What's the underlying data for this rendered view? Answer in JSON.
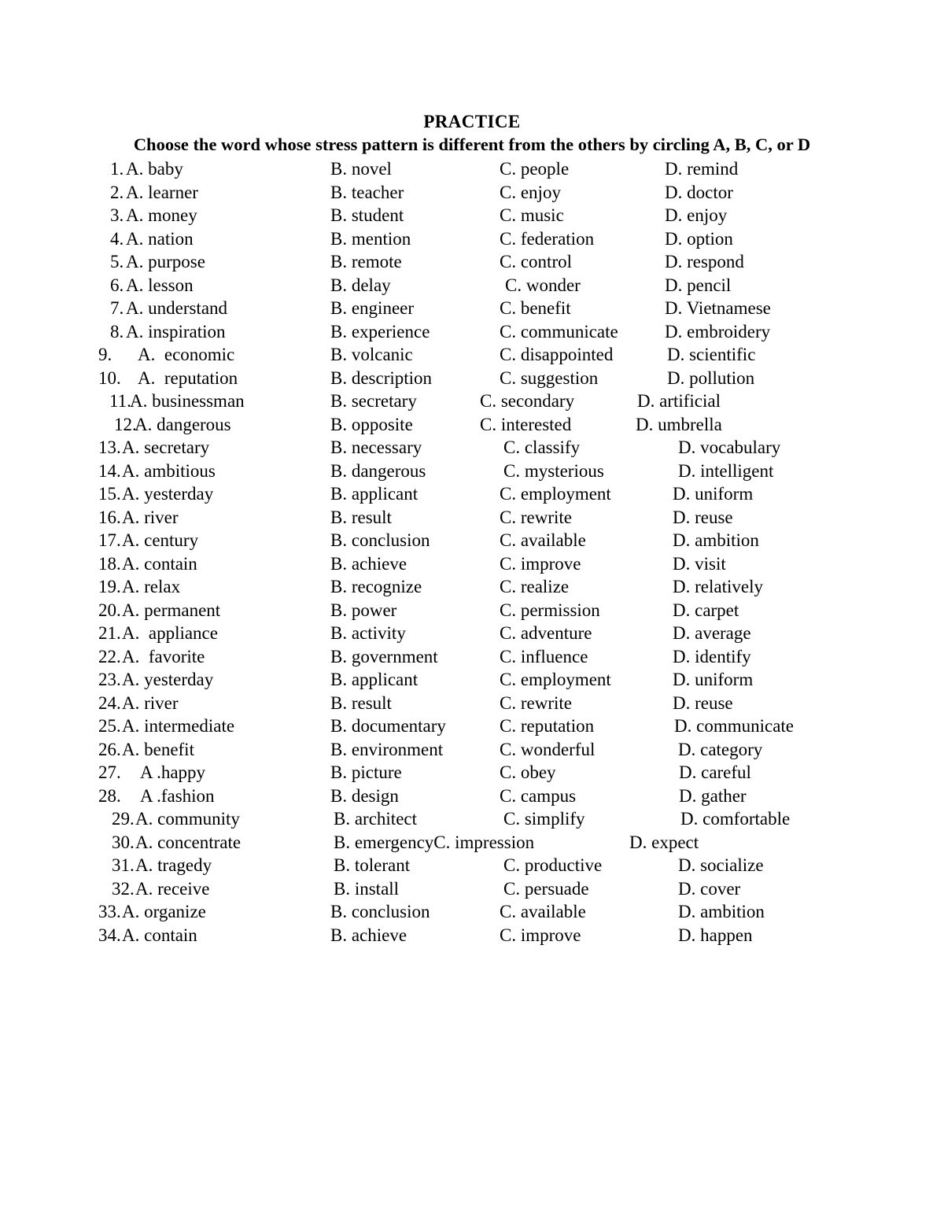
{
  "document": {
    "title": "PRACTICE",
    "instruction": "Choose the word whose stress pattern is different from the others by circling A, B, C, or D",
    "text_color": "#000000",
    "background_color": "#ffffff"
  },
  "questions": [
    {
      "number": "1.",
      "a": "A. baby",
      "b": "B. novel",
      "c": "C. people",
      "d": "D. remind",
      "x": {
        "num": 140,
        "a": 160,
        "b": 420,
        "c": 635,
        "d": 845
      }
    },
    {
      "number": "2.",
      "a": "A. learner",
      "b": "B. teacher",
      "c": "C. enjoy",
      "d": "D. doctor",
      "x": {
        "num": 140,
        "a": 160,
        "b": 420,
        "c": 635,
        "d": 845
      }
    },
    {
      "number": "3.",
      "a": "A. money",
      "b": "B. student",
      "c": "C. music",
      "d": "D. enjoy",
      "x": {
        "num": 140,
        "a": 160,
        "b": 420,
        "c": 635,
        "d": 845
      }
    },
    {
      "number": "4.",
      "a": "A. nation",
      "b": "B. mention",
      "c": "C. federation",
      "d": "D. option",
      "x": {
        "num": 140,
        "a": 160,
        "b": 420,
        "c": 635,
        "d": 845
      }
    },
    {
      "number": "5.",
      "a": "A. purpose",
      "b": "B. remote",
      "c": "C. control",
      "d": "D. respond",
      "x": {
        "num": 140,
        "a": 160,
        "b": 420,
        "c": 635,
        "d": 845
      }
    },
    {
      "number": "6.",
      "a": "A. lesson",
      "b": "B. delay",
      "c": "C. wonder",
      "d": "D. pencil",
      "x": {
        "num": 140,
        "a": 160,
        "b": 420,
        "c": 642,
        "d": 845
      }
    },
    {
      "number": "7.",
      "a": "A. understand",
      "b": "B. engineer",
      "c": "C. benefit",
      "d": "D. Vietnamese",
      "x": {
        "num": 140,
        "a": 160,
        "b": 420,
        "c": 635,
        "d": 845
      }
    },
    {
      "number": "8.",
      "a": "A. inspiration",
      "b": "B. experience",
      "c": "C. communicate",
      "d": "D. embroidery",
      "x": {
        "num": 140,
        "a": 160,
        "b": 420,
        "c": 635,
        "d": 845
      }
    },
    {
      "number": "9.",
      "a": "A.  economic",
      "b": "B. volcanic",
      "c": "C. disappointed",
      "d": "D. scientific",
      "x": {
        "num": 125,
        "a": 175,
        "b": 420,
        "c": 635,
        "d": 848
      }
    },
    {
      "number": "10.",
      "a": "A.  reputation",
      "b": "B. description",
      "c": "C. suggestion",
      "d": "D. pollution",
      "x": {
        "num": 125,
        "a": 175,
        "b": 420,
        "c": 635,
        "d": 848
      }
    },
    {
      "number": "11.",
      "a": "A. businessman",
      "b": "B. secretary",
      "c": "C. secondary",
      "d": "D. artificial",
      "x": {
        "num": 139,
        "a": 165,
        "b": 420,
        "c": 610,
        "d": 810
      }
    },
    {
      "number": "12.",
      "a": "A. dangerous",
      "b": "B. opposite",
      "c": "C. interested",
      "d": "D. umbrella",
      "x": {
        "num": 145,
        "a": 171,
        "b": 420,
        "c": 610,
        "d": 808
      }
    },
    {
      "number": "13.",
      "a": "A. secretary",
      "b": "B. necessary",
      "c": "C. classify",
      "d": "D. vocabulary",
      "x": {
        "num": 125,
        "a": 155,
        "b": 420,
        "c": 640,
        "d": 862
      }
    },
    {
      "number": "14.",
      "a": "A. ambitious",
      "b": "B. dangerous",
      "c": "C. mysterious",
      "d": "D. intelligent",
      "x": {
        "num": 125,
        "a": 155,
        "b": 420,
        "c": 640,
        "d": 862
      }
    },
    {
      "number": "15.",
      "a": "A. yesterday",
      "b": "B. applicant",
      "c": "C. employment",
      "d": "D. uniform",
      "x": {
        "num": 125,
        "a": 155,
        "b": 420,
        "c": 635,
        "d": 855
      }
    },
    {
      "number": "16.",
      "a": "A. river",
      "b": "B. result",
      "c": "C. rewrite",
      "d": "D. reuse",
      "x": {
        "num": 125,
        "a": 155,
        "b": 420,
        "c": 635,
        "d": 855
      }
    },
    {
      "number": "17.",
      "a": "A. century",
      "b": "B. conclusion",
      "c": "C. available",
      "d": "D. ambition",
      "x": {
        "num": 125,
        "a": 155,
        "b": 420,
        "c": 635,
        "d": 855
      }
    },
    {
      "number": "18.",
      "a": "A. contain",
      "b": "B. achieve",
      "c": "C. improve",
      "d": "D. visit",
      "x": {
        "num": 125,
        "a": 155,
        "b": 420,
        "c": 635,
        "d": 855
      }
    },
    {
      "number": "19.",
      "a": "A. relax",
      "b": "B. recognize",
      "c": "C. realize",
      "d": "D. relatively",
      "x": {
        "num": 125,
        "a": 155,
        "b": 420,
        "c": 635,
        "d": 855
      }
    },
    {
      "number": "20.",
      "a": "A. permanent",
      "b": "B. power",
      "c": "C. permission",
      "d": "D. carpet",
      "x": {
        "num": 125,
        "a": 155,
        "b": 420,
        "c": 635,
        "d": 855
      }
    },
    {
      "number": "21.",
      "a": "A.  appliance",
      "b": "B. activity",
      "c": "C. adventure",
      "d": "D. average",
      "x": {
        "num": 125,
        "a": 155,
        "b": 420,
        "c": 635,
        "d": 855
      }
    },
    {
      "number": "22.",
      "a": "A.  favorite",
      "b": "B. government",
      "c": "C. influence",
      "d": "D. identify",
      "x": {
        "num": 125,
        "a": 155,
        "b": 420,
        "c": 635,
        "d": 855
      }
    },
    {
      "number": "23.",
      "a": "A. yesterday",
      "b": "B. applicant",
      "c": "C. employment",
      "d": "D. uniform",
      "x": {
        "num": 125,
        "a": 155,
        "b": 420,
        "c": 635,
        "d": 855
      }
    },
    {
      "number": "24.",
      "a": "A. river",
      "b": "B. result",
      "c": "C. rewrite",
      "d": "D. reuse",
      "x": {
        "num": 125,
        "a": 155,
        "b": 420,
        "c": 635,
        "d": 855
      }
    },
    {
      "number": "25.",
      "a": "A. intermediate",
      "b": "B. documentary",
      "c": "C. reputation",
      "d": "D. communicate",
      "x": {
        "num": 125,
        "a": 155,
        "b": 420,
        "c": 635,
        "d": 857
      }
    },
    {
      "number": "26.",
      "a": "A. benefit",
      "b": "B. environment",
      "c": "C. wonderful",
      "d": "D. category",
      "x": {
        "num": 125,
        "a": 155,
        "b": 420,
        "c": 635,
        "d": 862
      }
    },
    {
      "number": "27.",
      "a": "A .happy",
      "b": "B. picture",
      "c": "C. obey",
      "d": "D. careful",
      "x": {
        "num": 125,
        "a": 178,
        "b": 420,
        "c": 635,
        "d": 863
      }
    },
    {
      "number": "28.",
      "a": "A .fashion",
      "b": "B. design",
      "c": "C. campus",
      "d": "D. gather",
      "x": {
        "num": 125,
        "a": 178,
        "b": 420,
        "c": 635,
        "d": 863
      }
    },
    {
      "number": "29.",
      "a": "A. community",
      "b": "B. architect",
      "c": "C. simplify",
      "d": "D. comfortable",
      "x": {
        "num": 142,
        "a": 172,
        "b": 424,
        "c": 640,
        "d": 865
      }
    },
    {
      "number": "30.",
      "a": "A. concentrate",
      "b": "B. emergencyC. impression",
      "c": "",
      "d": "D. expect",
      "x": {
        "num": 142,
        "a": 172,
        "b": 424,
        "c": 640,
        "d": 800
      }
    },
    {
      "number": "31.",
      "a": "A. tragedy",
      "b": "B. tolerant",
      "c": "C. productive",
      "d": "D. socialize",
      "x": {
        "num": 142,
        "a": 172,
        "b": 424,
        "c": 640,
        "d": 862
      }
    },
    {
      "number": "32.",
      "a": "A. receive",
      "b": "B. install",
      "c": "C. persuade",
      "d": "D. cover",
      "x": {
        "num": 142,
        "a": 172,
        "b": 424,
        "c": 640,
        "d": 862
      }
    },
    {
      "number": "33.",
      "a": "A. organize",
      "b": "B. conclusion",
      "c": "C. available",
      "d": "D. ambition",
      "x": {
        "num": 125,
        "a": 155,
        "b": 420,
        "c": 635,
        "d": 862
      }
    },
    {
      "number": "34.",
      "a": "A. contain",
      "b": "B. achieve",
      "c": "C. improve",
      "d": "D. happen",
      "x": {
        "num": 125,
        "a": 155,
        "b": 420,
        "c": 635,
        "d": 862
      }
    }
  ]
}
